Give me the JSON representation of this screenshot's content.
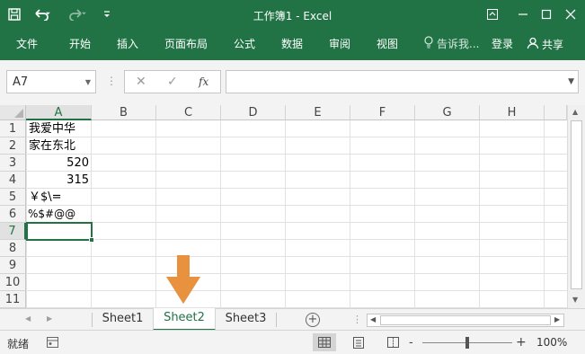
{
  "window": {
    "title": "工作簿1 - Excel"
  },
  "ribbon": {
    "tabs": [
      "文件",
      "开始",
      "插入",
      "页面布局",
      "公式",
      "数据",
      "审阅",
      "视图"
    ],
    "tell_me": "告诉我...",
    "login": "登录",
    "share": "共享"
  },
  "formula_bar": {
    "name_box": "A7",
    "formula": "",
    "fx_label": "fx"
  },
  "grid": {
    "columns": [
      "A",
      "B",
      "C",
      "D",
      "E",
      "F",
      "G",
      "H"
    ],
    "rows": [
      "1",
      "2",
      "3",
      "4",
      "5",
      "6",
      "7",
      "8",
      "9",
      "10",
      "11"
    ],
    "selected_column": "A",
    "selected_row": "7",
    "cells": {
      "A1": "我爱中华",
      "A2": "家在东北",
      "A3": "520",
      "A4": "315",
      "A5": "￥$\\=",
      "A6": "%$#@@"
    }
  },
  "sheets": {
    "tabs": [
      "Sheet1",
      "Sheet2",
      "Sheet3"
    ],
    "active": "Sheet2"
  },
  "status": {
    "ready": "就绪",
    "zoom_percent": "100%",
    "zoom_minus": "-",
    "zoom_plus": "+"
  },
  "colors": {
    "excel_green": "#217346",
    "annotation_arrow": "#e8913f"
  }
}
